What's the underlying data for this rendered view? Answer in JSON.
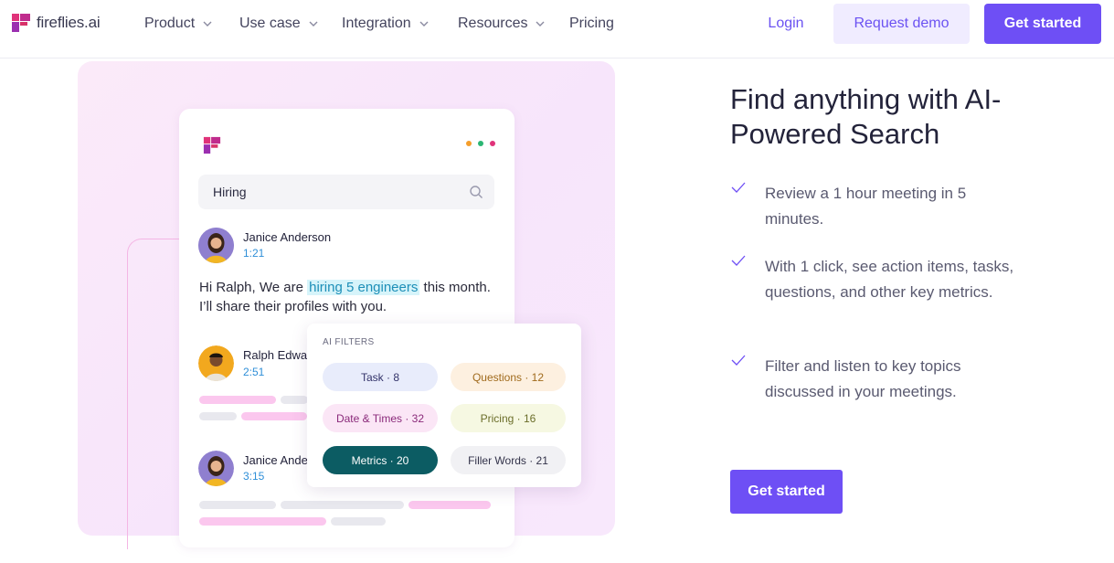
{
  "nav": {
    "logo_text": "fireflies.ai",
    "items": [
      {
        "label": "Product",
        "has_dropdown": true
      },
      {
        "label": "Use case",
        "has_dropdown": true
      },
      {
        "label": "Integration",
        "has_dropdown": true
      },
      {
        "label": "Resources",
        "has_dropdown": true
      },
      {
        "label": "Pricing",
        "has_dropdown": false
      }
    ],
    "login_label": "Login",
    "demo_label": "Request demo",
    "start_label": "Get started"
  },
  "illustration": {
    "search_query": "Hiring",
    "people": [
      {
        "name": "Janice Anderson",
        "time": "1:21"
      },
      {
        "name": "Ralph Edwa",
        "time": "2:51"
      },
      {
        "name": "Janice Ande",
        "time": "3:15"
      }
    ],
    "message": {
      "before": "Hi Ralph, We are ",
      "highlight": "hiring 5 engineers",
      "after": " this month. I’ll share their profiles with you."
    },
    "filters": {
      "title": "AI FILTERS",
      "chips": [
        {
          "label": "Task · 8",
          "bg": "#e8ecfb",
          "color": "#33336a"
        },
        {
          "label": "Questions · 12",
          "bg": "#fdf0e0",
          "color": "#a06a1c"
        },
        {
          "label": "Date & Times · 32",
          "bg": "#fbe6f6",
          "color": "#8a2a7a"
        },
        {
          "label": "Pricing · 16",
          "bg": "#f6f8e2",
          "color": "#6b6e2a"
        },
        {
          "label": "Metrics · 20",
          "bg": "#0c5c63",
          "color": "#ffffff"
        },
        {
          "label": "Filler Words · 21",
          "bg": "#f1f1f4",
          "color": "#33334a"
        }
      ]
    }
  },
  "content": {
    "headline": "Find anything with AI-Powered Search",
    "features": [
      "Review a 1 hour meeting in 5 minutes.",
      "With 1 click, see action items, tasks, questions, and other key metrics.",
      "Filter and listen to key topics discussed in your meetings."
    ],
    "cta_label": "Get started"
  },
  "colors": {
    "brand_purple": "#6e4ff5",
    "logo_pink": "#e0337a",
    "logo_purple": "#8a2be2",
    "check": "#6e4ff5"
  },
  "icons": [
    "fireflies-logo-icon",
    "chevron-down-icon",
    "search-icon",
    "check-icon"
  ]
}
